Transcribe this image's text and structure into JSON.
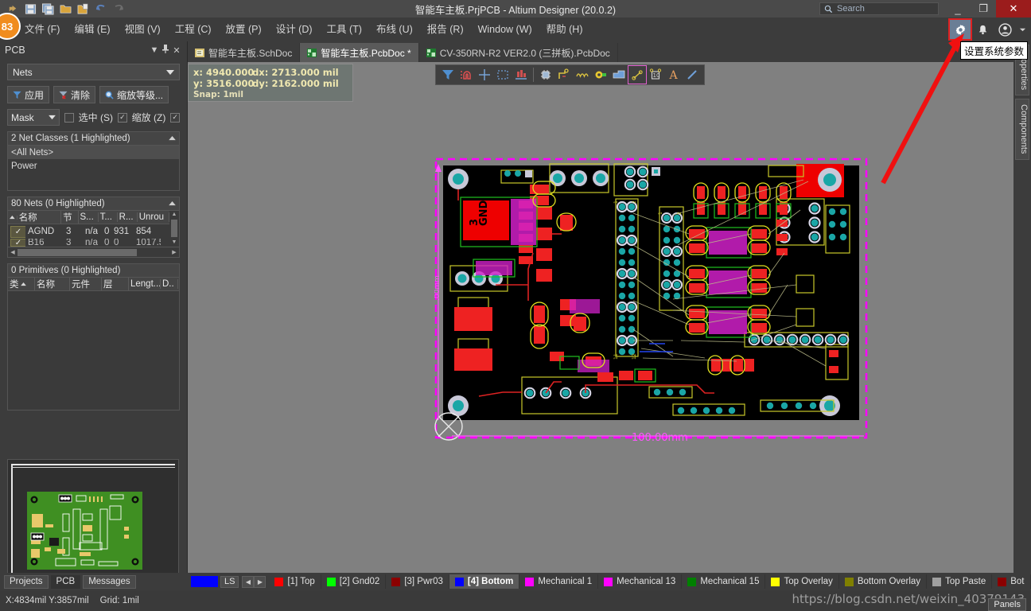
{
  "window": {
    "title": "智能车主板.PrjPCB - Altium Designer (20.0.2)",
    "search_placeholder": "Search",
    "minimize": "_",
    "restore": "❐",
    "close": "✕",
    "badge_count": "83"
  },
  "quick_toolbar": [
    {
      "name": "open-recent-icon",
      "glyph": "↱"
    },
    {
      "name": "save-icon",
      "glyph": "save"
    },
    {
      "name": "save-all-icon",
      "glyph": "save-all"
    },
    {
      "name": "open-folder-icon",
      "glyph": "folder"
    },
    {
      "name": "open-project-icon",
      "glyph": "folder-doc"
    },
    {
      "name": "undo-icon",
      "glyph": "↶"
    },
    {
      "name": "redo-icon",
      "glyph": "↷"
    }
  ],
  "menubar": {
    "items": [
      {
        "label": "文件 (F)"
      },
      {
        "label": "编辑 (E)"
      },
      {
        "label": "视图 (V)"
      },
      {
        "label": "工程 (C)"
      },
      {
        "label": "放置 (P)"
      },
      {
        "label": "设计 (D)"
      },
      {
        "label": "工具 (T)"
      },
      {
        "label": "布线 (U)"
      },
      {
        "label": "报告 (R)"
      },
      {
        "label": "Window (W)"
      },
      {
        "label": "帮助 (H)"
      }
    ],
    "tooltip": "设置系统参数"
  },
  "doc_tabs": [
    {
      "label": "智能车主板.SchDoc",
      "icon": "schematic-doc-icon",
      "active": false
    },
    {
      "label": "智能车主板.PcbDoc *",
      "icon": "pcb-doc-icon",
      "active": true
    },
    {
      "label": "CV-350RN-R2 VER2.0 (三拼板).PcbDoc",
      "icon": "pcb-doc-icon",
      "active": false
    }
  ],
  "pcb_panel": {
    "title": "PCB",
    "header_buttons": [
      "▼",
      "⚲",
      "✕"
    ],
    "scope_select": "Nets",
    "buttons": [
      {
        "label": "应用",
        "icon": "funnel-icon"
      },
      {
        "label": "清除",
        "icon": "funnel-clear-icon"
      },
      {
        "label": "缩放等级...",
        "icon": "magnifier-icon"
      }
    ],
    "mask_select": "Mask",
    "checkboxes": [
      {
        "label": "选中 (S)",
        "checked": false
      },
      {
        "label": "缩放 (Z)",
        "checked": true
      },
      {
        "label": "",
        "checked": true
      }
    ],
    "net_classes": {
      "header": "2 Net Classes (1 Highlighted)",
      "rows": [
        "<All Nets>",
        "Power"
      ],
      "selected_index": 0
    },
    "nets": {
      "header": "80 Nets (0 Highlighted)",
      "columns": [
        "名称",
        "节",
        "S...",
        "T...",
        "R...",
        "Unrou"
      ],
      "rows": [
        {
          "checked": true,
          "name": "AGND",
          "jie": "3",
          "s": "n/a",
          "t": "0",
          "r": "931",
          "unrou": "854"
        },
        {
          "checked": true,
          "name": "B16",
          "jie": "3",
          "s": "n/a",
          "t": "0",
          "r": "0",
          "unrou": "1017.5"
        }
      ]
    },
    "primitives": {
      "header": "0 Primitives (0 Highlighted)",
      "columns": [
        "类",
        "名称",
        "元件",
        "层",
        "Lengt...",
        "D.."
      ],
      "rows": []
    }
  },
  "right_dock": {
    "tabs": [
      "Properties",
      "Components"
    ]
  },
  "canvas": {
    "coords": {
      "x_label": "x:",
      "x_value": "4940.000",
      "dx_label": "dx:",
      "dx_value": "2713.000 mil",
      "y_label": "y:",
      "y_value": "3516.000",
      "dy_label": "dy:",
      "dy_value": "2162.000 mil",
      "snap": "Snap: 1mil"
    },
    "dimension_label": "100.00mm",
    "board_label_gnd": "GND",
    "board_label_3": "3",
    "toolbar_icons": [
      {
        "name": "filter-icon",
        "boxed": false
      },
      {
        "name": "magnet-icon",
        "boxed": false
      },
      {
        "name": "crosshair-place-icon",
        "boxed": false
      },
      {
        "name": "select-area-icon",
        "boxed": false
      },
      {
        "name": "align-icon",
        "boxed": false
      },
      {
        "name": "place-component-icon",
        "boxed": false
      },
      {
        "name": "interactive-route-icon",
        "boxed": false
      },
      {
        "name": "differential-pair-route-icon",
        "boxed": false
      },
      {
        "name": "place-via-icon",
        "boxed": false
      },
      {
        "name": "place-polygon-icon",
        "boxed": false
      },
      {
        "name": "place-line-route-icon",
        "boxed": true
      },
      {
        "name": "place-dimension-icon",
        "boxed": false
      },
      {
        "name": "place-string-icon",
        "boxed": false
      },
      {
        "name": "place-line-icon",
        "boxed": false
      }
    ]
  },
  "layer_bar": {
    "ls_label": "LS",
    "ls_color": "#0000ff",
    "prev_arrow": "◀",
    "next_arrow": "▶",
    "layers": [
      {
        "label": "[1] Top",
        "color": "#ff0000",
        "active": false
      },
      {
        "label": "[2] Gnd02",
        "color": "#00ff00",
        "active": false
      },
      {
        "label": "[3] Pwr03",
        "color": "#8b0000",
        "active": false
      },
      {
        "label": "[4] Bottom",
        "color": "#0000ff",
        "active": true
      },
      {
        "label": "Mechanical 1",
        "color": "#ff00ff",
        "active": false
      },
      {
        "label": "Mechanical 13",
        "color": "#ff00ff",
        "active": false
      },
      {
        "label": "Mechanical 15",
        "color": "#008000",
        "active": false
      },
      {
        "label": "Top Overlay",
        "color": "#ffff00",
        "active": false
      },
      {
        "label": "Bottom Overlay",
        "color": "#808000",
        "active": false
      },
      {
        "label": "Top Paste",
        "color": "#a0a0a0",
        "active": false
      },
      {
        "label": "Bot",
        "color": "#8b0000",
        "active": false
      }
    ]
  },
  "panel_strip": {
    "tabs": [
      {
        "label": "Projects",
        "active": false
      },
      {
        "label": "PCB",
        "active": true
      },
      {
        "label": "Messages",
        "active": false
      }
    ]
  },
  "status_bar": {
    "coords": "X:4834mil Y:3857mil",
    "grid": "Grid: 1mil",
    "panels_button": "Panels",
    "watermark": "https://blog.csdn.net/weixin_40379143"
  }
}
